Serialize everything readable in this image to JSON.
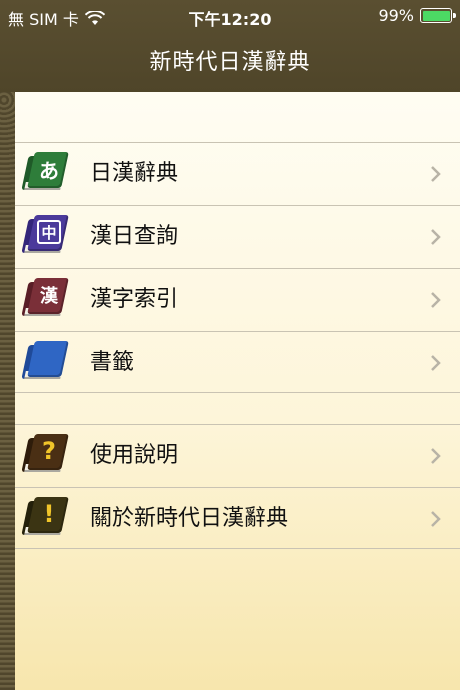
{
  "status_bar": {
    "carrier": "無 SIM 卡",
    "time": "下午12:20",
    "battery": "99%",
    "battery_level": 0.99
  },
  "nav": {
    "title": "新時代日漢辭典"
  },
  "menu": {
    "group1": [
      {
        "label": "日漢辭典",
        "icon": "hiragana-a-book-icon",
        "glyph": "あ",
        "color": "#2e7d3a"
      },
      {
        "label": "漢日查詢",
        "icon": "chinese-zhong-book-icon",
        "glyph": "中",
        "color": "#4b3a9b"
      },
      {
        "label": "漢字索引",
        "icon": "kanji-kan-book-icon",
        "glyph": "漢",
        "color": "#7a2f38"
      },
      {
        "label": "書籤",
        "icon": "blue-bookmark-book-icon",
        "glyph": "",
        "color": "#2f66c4"
      }
    ],
    "group2": [
      {
        "label": "使用說明",
        "icon": "question-mark-book-icon",
        "glyph": "?",
        "color": "#4a2f14"
      },
      {
        "label": "關於新時代日漢辭典",
        "icon": "exclamation-book-icon",
        "glyph": "!",
        "color": "#3b3413"
      }
    ]
  },
  "colors": {
    "nav_bg": "#524829",
    "content_top": "#fffdf3",
    "content_bottom": "#f7e6ad",
    "accent_yellow": "#f0c52a",
    "chevron": "#b8b3a6"
  }
}
